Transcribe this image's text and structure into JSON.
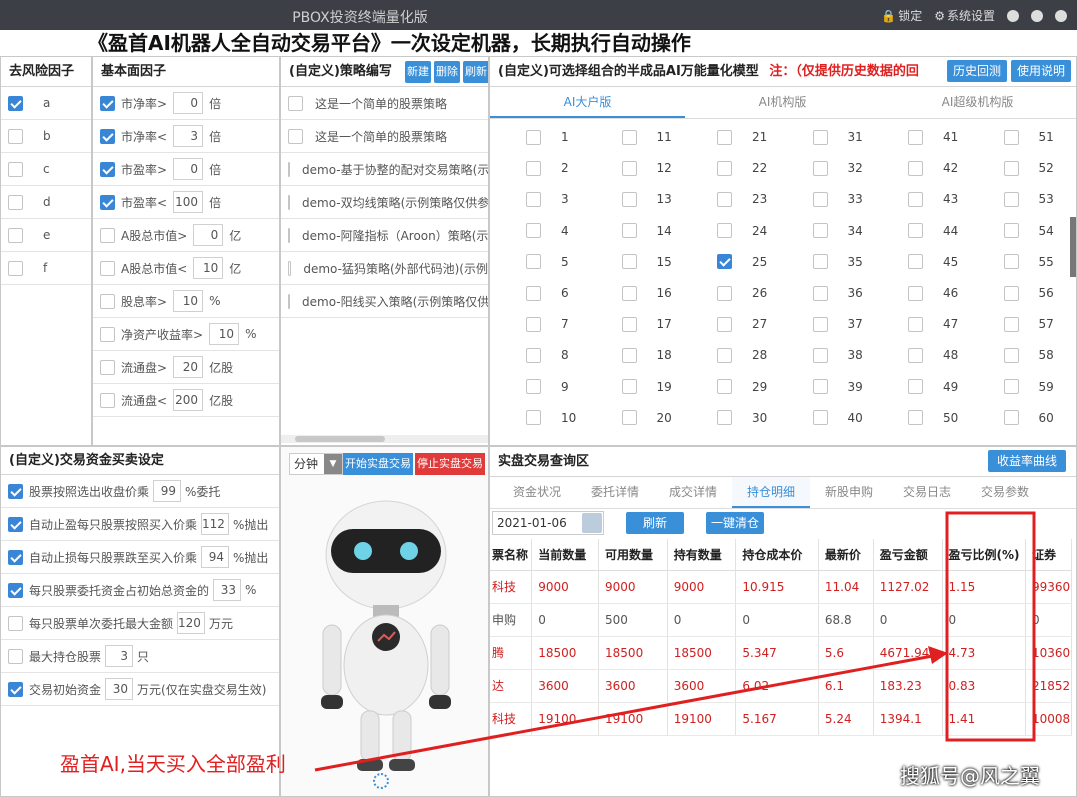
{
  "window": {
    "title": "PBOX投资终端量化版",
    "lock": "锁定",
    "settings": "系统设置"
  },
  "banner": "《盈首AI机器人全自动交易平台》一次设定机器，长期执行自动操作",
  "risk": {
    "header": "去风险因子",
    "items": [
      {
        "label": "a",
        "checked": true
      },
      {
        "label": "b",
        "checked": false
      },
      {
        "label": "c",
        "checked": false
      },
      {
        "label": "d",
        "checked": false
      },
      {
        "label": "e",
        "checked": false
      },
      {
        "label": "f",
        "checked": false
      }
    ]
  },
  "fundamental": {
    "header": "基本面因子",
    "items": [
      {
        "label": "市净率>",
        "value": "0",
        "unit": "倍",
        "checked": true
      },
      {
        "label": "市净率<",
        "value": "3",
        "unit": "倍",
        "checked": true
      },
      {
        "label": "市盈率>",
        "value": "0",
        "unit": "倍",
        "checked": true
      },
      {
        "label": "市盈率<",
        "value": "100",
        "unit": "倍",
        "checked": true
      },
      {
        "label": "A股总市值>",
        "value": "0",
        "unit": "亿",
        "checked": false
      },
      {
        "label": "A股总市值<",
        "value": "10",
        "unit": "亿",
        "checked": false
      },
      {
        "label": "股息率>",
        "value": "10",
        "unit": "%",
        "checked": false
      },
      {
        "label": "净资产收益率>",
        "value": "10",
        "unit": "%",
        "checked": false
      },
      {
        "label": "流通盘>",
        "value": "20",
        "unit": "亿股",
        "checked": false
      },
      {
        "label": "流通盘<",
        "value": "200",
        "unit": "亿股",
        "checked": false
      }
    ]
  },
  "strategy": {
    "header": "(自定义)策略编写",
    "new": "新建",
    "delete": "删除",
    "refresh": "刷新",
    "items": [
      "这是一个简单的股票策略",
      "这是一个简单的股票策略",
      "demo-基于协整的配对交易策略(示",
      "demo-双均线策略(示例策略仅供参",
      "demo-阿隆指标（Aroon）策略(示",
      "demo-猛犸策略(外部代码池)(示例",
      "demo-阳线买入策略(示例策略仅供"
    ]
  },
  "models": {
    "header": "(自定义)可选择组合的半成品AI万能量化模型",
    "note": "注：（仅提供历史数据的回",
    "backtest": "历史回测",
    "manual": "使用说明",
    "tabs": [
      "AI大户版",
      "AI机构版",
      "AI超级机构版"
    ],
    "checked": [
      25
    ]
  },
  "funds": {
    "header": "(自定义)交易资金买卖设定",
    "items": [
      {
        "label": "股票按照选出收盘价乘",
        "value": "99",
        "suffix": "%委托",
        "checked": true
      },
      {
        "label": "自动止盈每只股票按照买入价乘",
        "value": "112",
        "suffix": "%抛出",
        "checked": true
      },
      {
        "label": "自动止损每只股票跌至买入价乘",
        "value": "94",
        "suffix": "%抛出",
        "checked": true
      },
      {
        "label": "每只股票委托资金占初始总资金的",
        "value": "33",
        "suffix": "%",
        "checked": true
      },
      {
        "label": "每只股票单次委托最大金额",
        "value": "120",
        "suffix": "万元",
        "checked": false
      },
      {
        "label": "最大持仓股票",
        "value": "3",
        "suffix": "只",
        "checked": false
      },
      {
        "label": "交易初始资金",
        "value": "30",
        "suffix": "万元(仅在实盘交易生效)",
        "checked": true
      }
    ]
  },
  "control": {
    "interval": "分钟",
    "start": "开始实盘交易",
    "stop": "停止实盘交易"
  },
  "query": {
    "header": "实盘交易查询区",
    "curve": "收益率曲线",
    "tabs": [
      "资金状况",
      "委托详情",
      "成交详情",
      "持仓明细",
      "新股申购",
      "交易日志",
      "交易参数"
    ],
    "active_tab": 3,
    "date": "2021-01-06",
    "refresh": "刷新",
    "clear": "一键清仓",
    "columns": [
      "票名称",
      "当前数量",
      "可用数量",
      "持有数量",
      "持仓成本价",
      "最新价",
      "盈亏金额",
      "盈亏比例(%)",
      "证券"
    ],
    "rows": [
      [
        "科技",
        "9000",
        "9000",
        "9000",
        "10.915",
        "11.04",
        "1127.02",
        "1.15",
        "99360"
      ],
      [
        "申购",
        "0",
        "500",
        "0",
        "0",
        "68.8",
        "0",
        "0",
        "0"
      ],
      [
        "腾",
        "18500",
        "18500",
        "18500",
        "5.347",
        "5.6",
        "4671.94",
        "4.73",
        "10360"
      ],
      [
        "达",
        "3600",
        "3600",
        "3600",
        "6.02",
        "6.1",
        "183.23",
        "0.83",
        "21852"
      ],
      [
        "科技",
        "19100",
        "19100",
        "19100",
        "5.167",
        "5.24",
        "1394.1",
        "1.41",
        "10008"
      ]
    ]
  },
  "annotation": "盈首AI,当天买入全部盈利",
  "watermark": "搜狐号@风之翼",
  "colors": {
    "accent": "#3a8fd9",
    "red": "#e02020",
    "titlebar": "#3d3f46"
  }
}
